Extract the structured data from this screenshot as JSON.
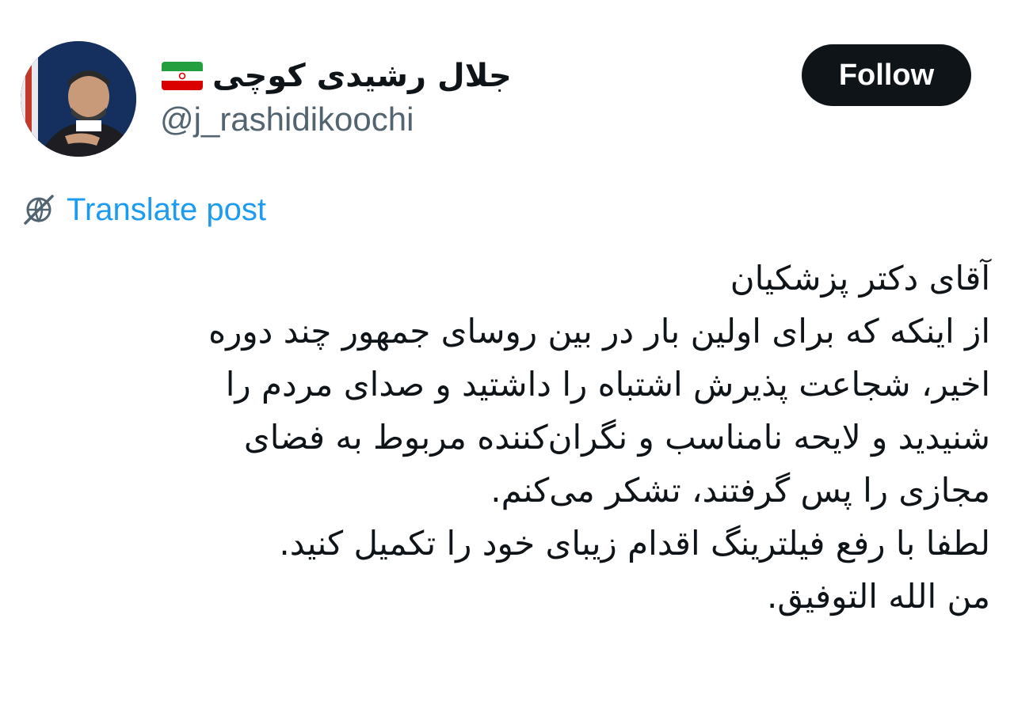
{
  "author": {
    "display_name": "جلال رشیدی کوچی",
    "handle": "@j_rashidikoochi",
    "flag_icon": "iran-flag-icon",
    "avatar_icon": "profile-photo"
  },
  "actions": {
    "follow_label": "Follow"
  },
  "translate": {
    "label": "Translate post",
    "icon": "globe-slash-icon"
  },
  "post": {
    "lines": [
      "آقای دکتر پزشکیان",
      "از اینکه که برای اولین بار در بین روسای جمهور چند دوره",
      "اخیر، شجاعت پذیرش اشتباه را داشتید و صدای مردم را",
      "شنیدید و لایحه نامناسب و نگران‌کننده مربوط به فضای",
      "مجازی را پس گرفتند، تشکر می‌کنم.",
      "لطفا با رفع فیلترینگ اقدام زیبای خود را تکمیل کنید.",
      "من الله التوفیق."
    ]
  },
  "colors": {
    "text": "#0f1419",
    "secondary": "#536471",
    "link": "#1d9bf0",
    "button_bg": "#0f1419",
    "button_text": "#ffffff"
  }
}
